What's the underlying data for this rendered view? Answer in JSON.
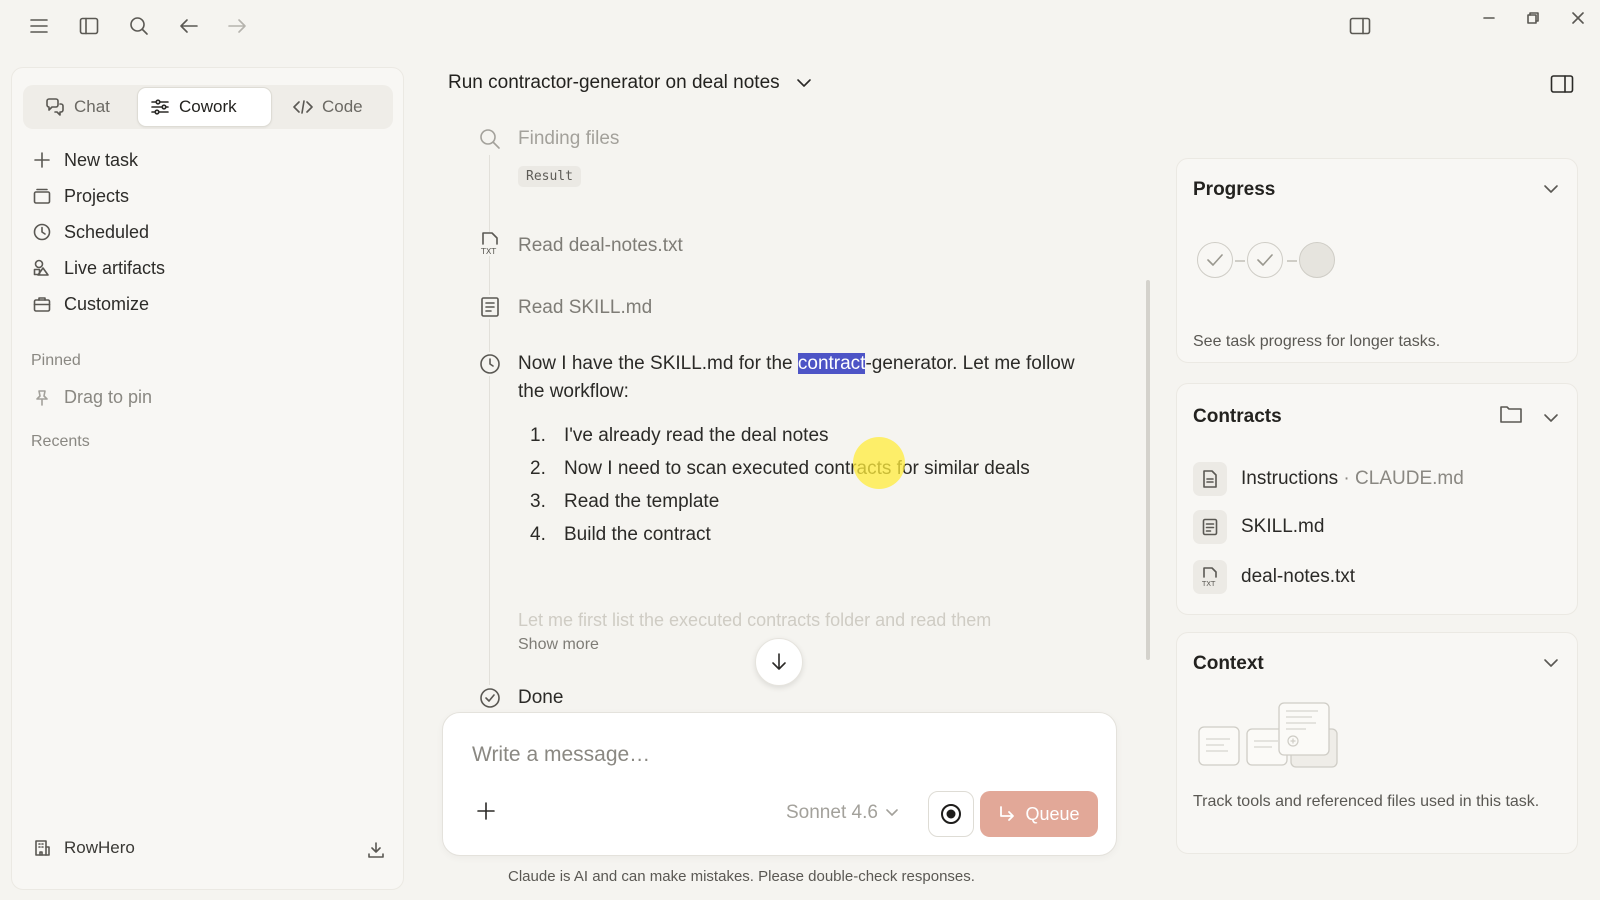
{
  "sidebar": {
    "modes": [
      {
        "label": "Chat",
        "active": false,
        "icon": "chat-bubbles-icon"
      },
      {
        "label": "Cowork",
        "active": true,
        "icon": "sliders-icon"
      },
      {
        "label": "Code",
        "active": false,
        "icon": "code-icon"
      }
    ],
    "nav": [
      {
        "label": "New task",
        "icon": "plus-icon"
      },
      {
        "label": "Projects",
        "icon": "folder-icon"
      },
      {
        "label": "Scheduled",
        "icon": "clock-icon"
      },
      {
        "label": "Live artifacts",
        "icon": "shapes-icon"
      },
      {
        "label": "Customize",
        "icon": "briefcase-icon"
      }
    ],
    "pinned_label": "Pinned",
    "drag_to_pin": "Drag to pin",
    "recents_label": "Recents",
    "workspace": "RowHero"
  },
  "main": {
    "title": "Run contractor-generator on deal notes",
    "steps": {
      "finding_files": "Finding files",
      "result_badge": "Result",
      "read_deal_notes": "Read deal-notes.txt",
      "read_skill": "Read SKILL.md"
    },
    "message": {
      "before": "Now I have the SKILL.md for the ",
      "highlight": "contract",
      "after": "-generator. Let me follow the workflow:"
    },
    "workflow": [
      {
        "n": "1.",
        "text": "I've already read the deal notes"
      },
      {
        "n": "2.",
        "text": "Now I need to scan executed contracts for similar deals"
      },
      {
        "n": "3.",
        "text": "Read the template"
      },
      {
        "n": "4.",
        "text": "Build the contract"
      }
    ],
    "faded_text": "Let me first list the executed contracts folder and read them",
    "show_more": "Show more",
    "done": "Done"
  },
  "composer": {
    "placeholder": "Write a message…",
    "model": "Sonnet 4.6",
    "queue_label": "Queue",
    "disclaimer": "Claude is AI and can make mistakes. Please double-check responses."
  },
  "panel": {
    "progress": {
      "title": "Progress",
      "steps_done": 2,
      "steps_total": 3,
      "hint": "See task progress for longer tasks."
    },
    "contracts": {
      "title": "Contracts",
      "files": [
        {
          "name": "Instructions",
          "sep": " · ",
          "secondary": "CLAUDE.md"
        },
        {
          "name": "SKILL.md"
        },
        {
          "name": "deal-notes.txt"
        }
      ]
    },
    "context": {
      "title": "Context",
      "hint": "Track tools and referenced files used in this task."
    }
  },
  "colors": {
    "background": "#f5f4f0",
    "highlight": "#4d54c6",
    "queue_button": "#e2a898"
  }
}
